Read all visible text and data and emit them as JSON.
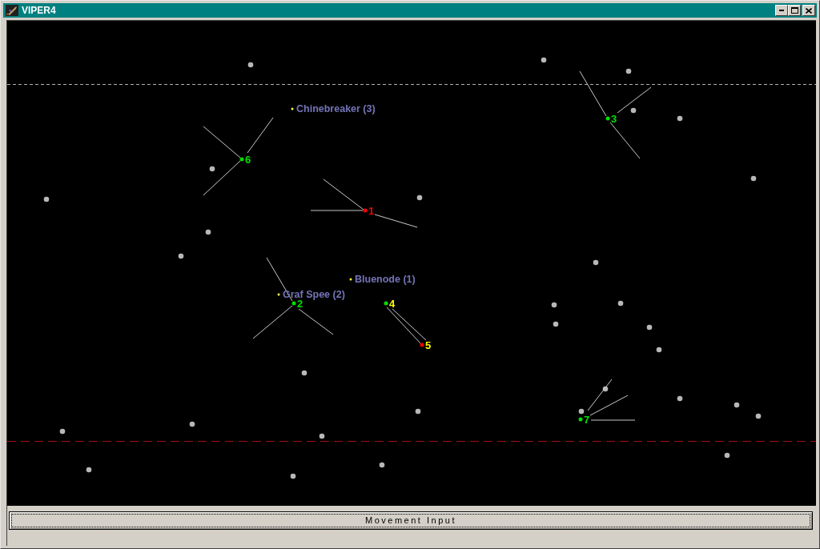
{
  "window": {
    "title": "VIPER4"
  },
  "map": {
    "places": [
      {
        "name": "Chinebreaker (3)"
      },
      {
        "name": "Bluenode (1)"
      },
      {
        "name": "Graf Spee (2)"
      }
    ],
    "units": [
      {
        "label": "1",
        "color": "#ff0000",
        "selected": false
      },
      {
        "label": "2",
        "color": "#00e000",
        "selected": false
      },
      {
        "label": "3",
        "color": "#00e000",
        "selected": false
      },
      {
        "label": "4",
        "color": "#00e000",
        "selected": true
      },
      {
        "label": "5",
        "color": "#ff0000",
        "selected": true
      },
      {
        "label": "6",
        "color": "#00e000",
        "selected": false
      },
      {
        "label": "7",
        "color": "#00e000",
        "selected": false
      }
    ]
  },
  "button": {
    "label": "Movement Input"
  }
}
